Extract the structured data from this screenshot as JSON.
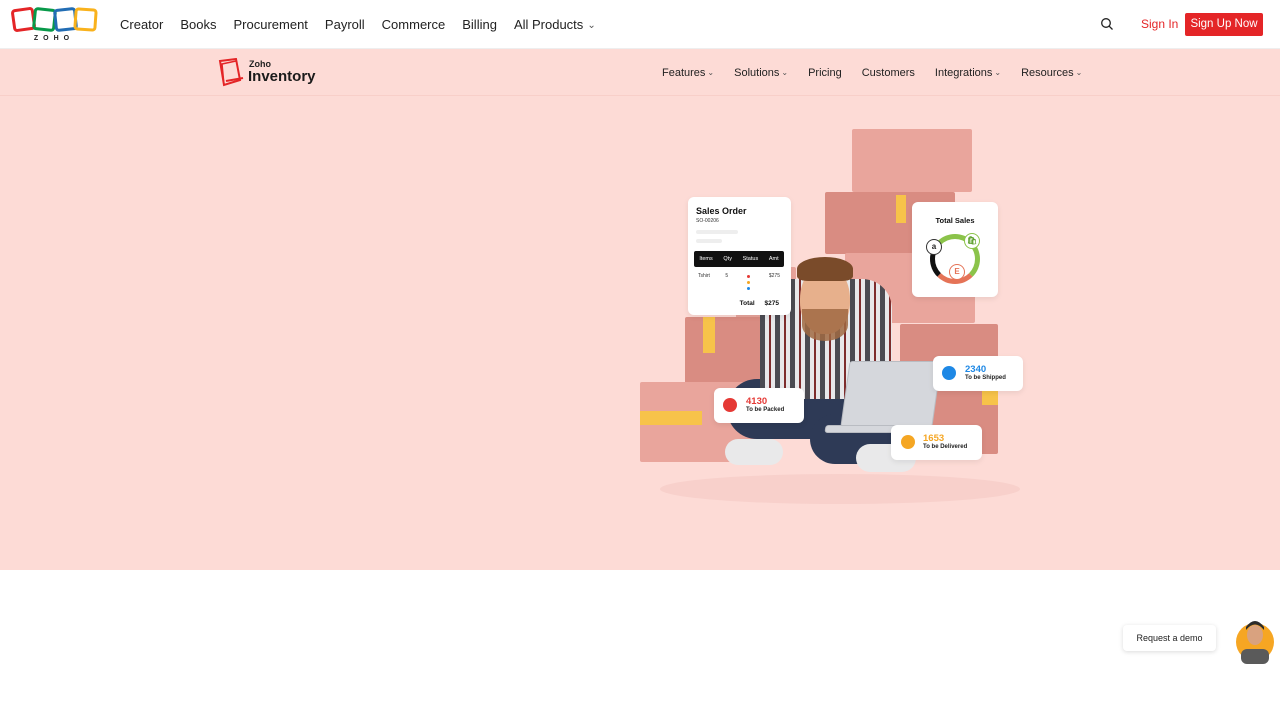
{
  "topbar": {
    "logo_text": "ZOHO",
    "nav": [
      "Creator",
      "Books",
      "Procurement",
      "Payroll",
      "Commerce",
      "Billing",
      "All Products"
    ],
    "signin": "Sign In",
    "signup": "Sign Up Now",
    "logo_colors": [
      "#e42527",
      "#089949",
      "#226db4",
      "#f9b21d"
    ]
  },
  "subnav": {
    "brand_small": "Zoho",
    "brand_name": "Inventory",
    "items": [
      "Features",
      "Solutions",
      "Pricing",
      "Customers",
      "Integrations",
      "Resources"
    ]
  },
  "sales_order": {
    "title": "Sales Order",
    "number": "SO-00206",
    "headers": [
      "Items",
      "Qty",
      "Status",
      "Amt"
    ],
    "row": [
      "Tshirt",
      "5",
      "",
      "$275"
    ],
    "total_label": "Total",
    "total_value": "$275"
  },
  "total_sales": {
    "title": "Total Sales",
    "badges": [
      "a",
      "E"
    ]
  },
  "stats": {
    "shipped": {
      "value": "2340",
      "label": "To be Shipped",
      "color": "#1e88e5"
    },
    "packed": {
      "value": "4130",
      "label": "To be Packed",
      "color": "#e53935"
    },
    "delivered": {
      "value": "1653",
      "label": "To be Delivered",
      "color": "#f5a623"
    }
  },
  "demo": {
    "label": "Request a demo"
  },
  "colors": {
    "accent": "#e42527",
    "hero_bg": "#fddbd6"
  }
}
